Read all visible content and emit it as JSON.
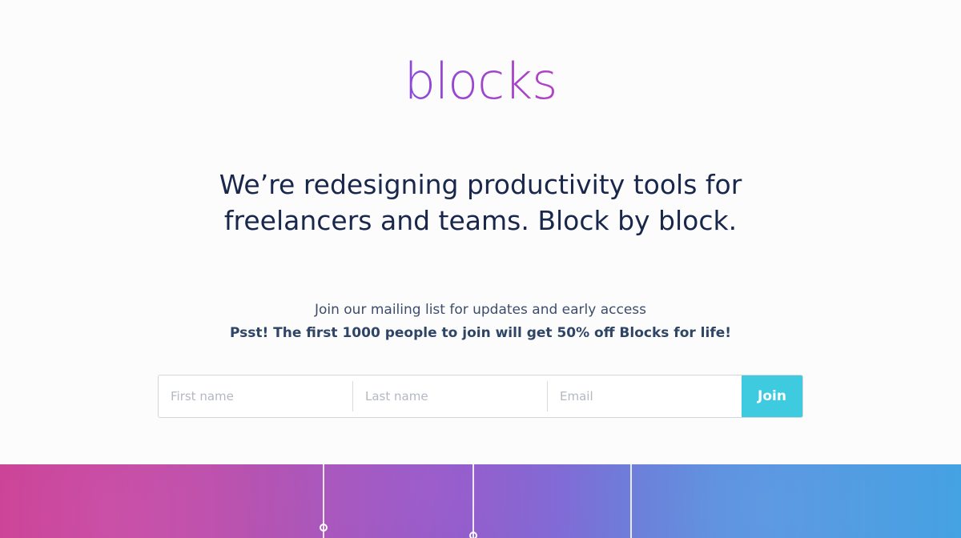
{
  "brand": {
    "logo_text": "blocks",
    "gradient": [
      "#2f6cf0",
      "#7b4be3",
      "#c23fb8",
      "#e0407f"
    ]
  },
  "hero": {
    "headline_line1": "We’re redesigning productivity tools for",
    "headline_line2": "freelancers and teams. Block by block."
  },
  "signup": {
    "subtitle": "Join our mailing list for updates and early access",
    "promo": "Psst! The first 1000 people to join will get 50% off Blocks for life!",
    "first_name_placeholder": "First name",
    "last_name_placeholder": "Last name",
    "email_placeholder": "Email",
    "join_label": "Join",
    "join_color": "#3ecbe0"
  },
  "banner": {
    "colors": [
      "#c23a8e",
      "#8f56c0",
      "#3f9ee0"
    ]
  }
}
